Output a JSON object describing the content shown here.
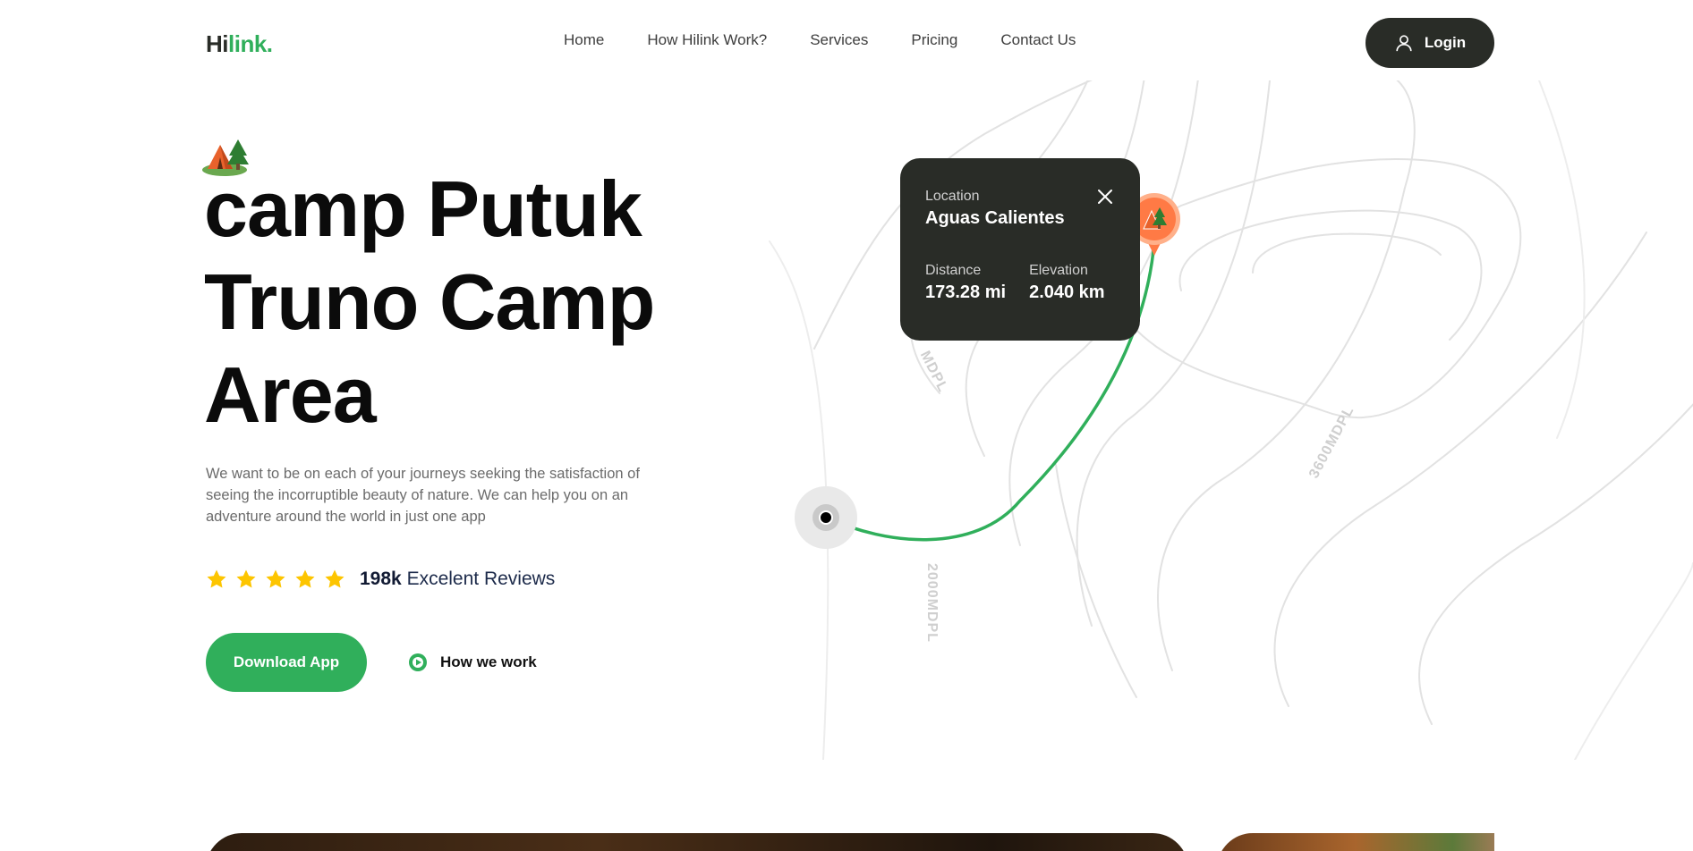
{
  "logo": {
    "part1": "Hi",
    "part2": "link."
  },
  "nav": {
    "items": [
      "Home",
      "How Hilink Work?",
      "Services",
      "Pricing",
      "Contact Us"
    ],
    "login_label": "Login"
  },
  "hero": {
    "title": "camp Putuk Truno Camp Area",
    "description": "We want to be on each of your journeys seeking the satisfaction of seeing the incorruptible beauty of nature. We can help you on an adventure around the world in just one app",
    "rating_stars": 5,
    "reviews_count": "198k",
    "reviews_label": "Excelent Reviews",
    "download_label": "Download App",
    "how_we_work_label": "How we work"
  },
  "map": {
    "contour_labels": [
      "MDPL",
      "2000MDPL",
      "3600MDPL"
    ]
  },
  "card": {
    "location_label": "Location",
    "location_value": "Aguas Calientes",
    "distance_label": "Distance",
    "distance_value": "173.28 mi",
    "elevation_label": "Elevation",
    "elevation_value": "2.040 km"
  },
  "colors": {
    "brand_green": "#30af5b",
    "dark": "#292c27",
    "star": "#fdc500",
    "pin_orange": "#ff7a45"
  }
}
